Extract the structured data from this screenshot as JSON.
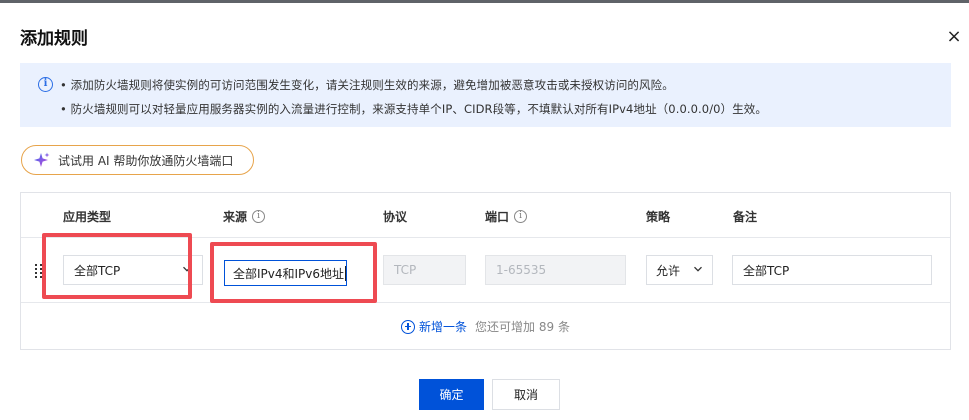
{
  "dialog": {
    "title": "添加规则",
    "close_glyph": "×"
  },
  "notice": {
    "icon": "info-circle-icon",
    "icon_glyph": "i",
    "lines": [
      "• 添加防火墙规则将使实例的可访问范围发生变化，请关注规则生效的来源，避免增加被恶意攻击或未授权访问的风险。",
      "• 防火墙规则可以对轻量应用服务器实例的入流量进行控制，来源支持单个IP、CIDR段等，不填默认对所有IPv4地址（0.0.0.0/0）生效。"
    ]
  },
  "ai_button": {
    "label": "试试用 AI 帮助你放通防火墙端口",
    "icon": "ai-sparkle-icon",
    "accent_color": "#e7a44b"
  },
  "table": {
    "headers": {
      "app_type": "应用类型",
      "source": "来源",
      "protocol": "协议",
      "port": "端口",
      "policy": "策略",
      "remark": "备注"
    },
    "info_glyph": "i",
    "row": {
      "app_type": "全部TCP",
      "source": "全部IPv4和IPv6地址",
      "protocol": "TCP",
      "port": "1-65535",
      "policy": "允许",
      "remark": "全部TCP"
    }
  },
  "add_row": {
    "link_label": "新增一条",
    "hint": "您还可增加 89 条"
  },
  "footer": {
    "confirm_label": "确定",
    "cancel_label": "取消"
  },
  "colors": {
    "primary": "#0052d9",
    "highlight": "#ee4a52",
    "notice_bg": "#eaf1fe"
  }
}
